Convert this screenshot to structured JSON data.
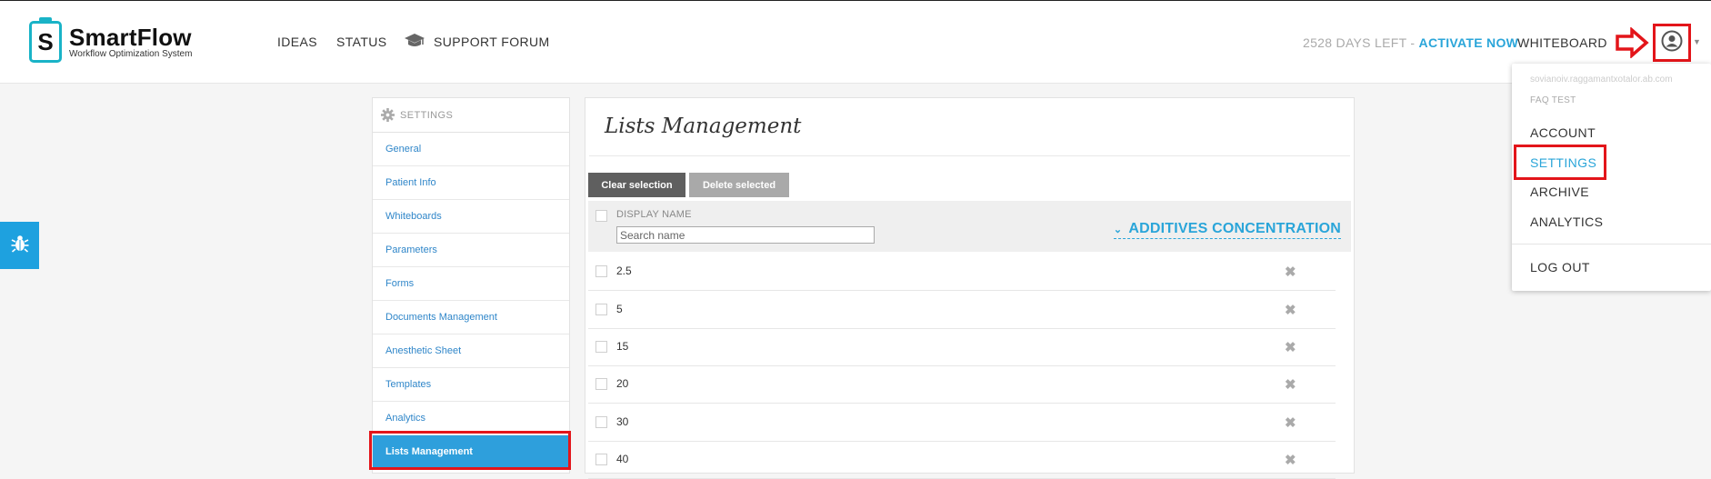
{
  "brand": {
    "name": "SmartFlow",
    "tagline": "Workflow Optimization System",
    "badge_letter": "S",
    "color": "#19b3c7"
  },
  "topnav": {
    "items": [
      "IDEAS",
      "STATUS",
      "SUPPORT FORUM"
    ],
    "support_icon": "graduation-cap-icon",
    "days_left": "2528 DAYS LEFT -",
    "activate": "ACTIVATE NOW",
    "whiteboard": "WHITEBOARD",
    "user_icon": "user-circle-icon",
    "accent": "#2aa5d9",
    "highlight": "#e3151a"
  },
  "user_menu": {
    "email": "sovianoiv.raggamantxotalor.ab.com",
    "account_name": "FAQ TEST",
    "items": [
      "ACCOUNT",
      "SETTINGS",
      "ARCHIVE",
      "ANALYTICS"
    ],
    "active_item": "SETTINGS",
    "logout": "LOG OUT"
  },
  "sidebar": {
    "header": "SETTINGS",
    "header_icon": "gear-icon",
    "items": [
      "General",
      "Patient Info",
      "Whiteboards",
      "Parameters",
      "Forms",
      "Documents Management",
      "Anesthetic Sheet",
      "Templates",
      "Analytics",
      "Lists Management"
    ],
    "active_item": "Lists Management"
  },
  "main": {
    "title": "Lists Management",
    "clear_button": "Clear selection",
    "delete_button": "Delete selected",
    "column_header": "DISPLAY NAME",
    "search_placeholder": "Search name",
    "list_selector": "ADDITIVES CONCENTRATION",
    "rows": [
      "2.5",
      "5",
      "15",
      "20",
      "30",
      "40"
    ],
    "delete_icon": "close-icon"
  },
  "side_tab_icon": "bug-icon"
}
